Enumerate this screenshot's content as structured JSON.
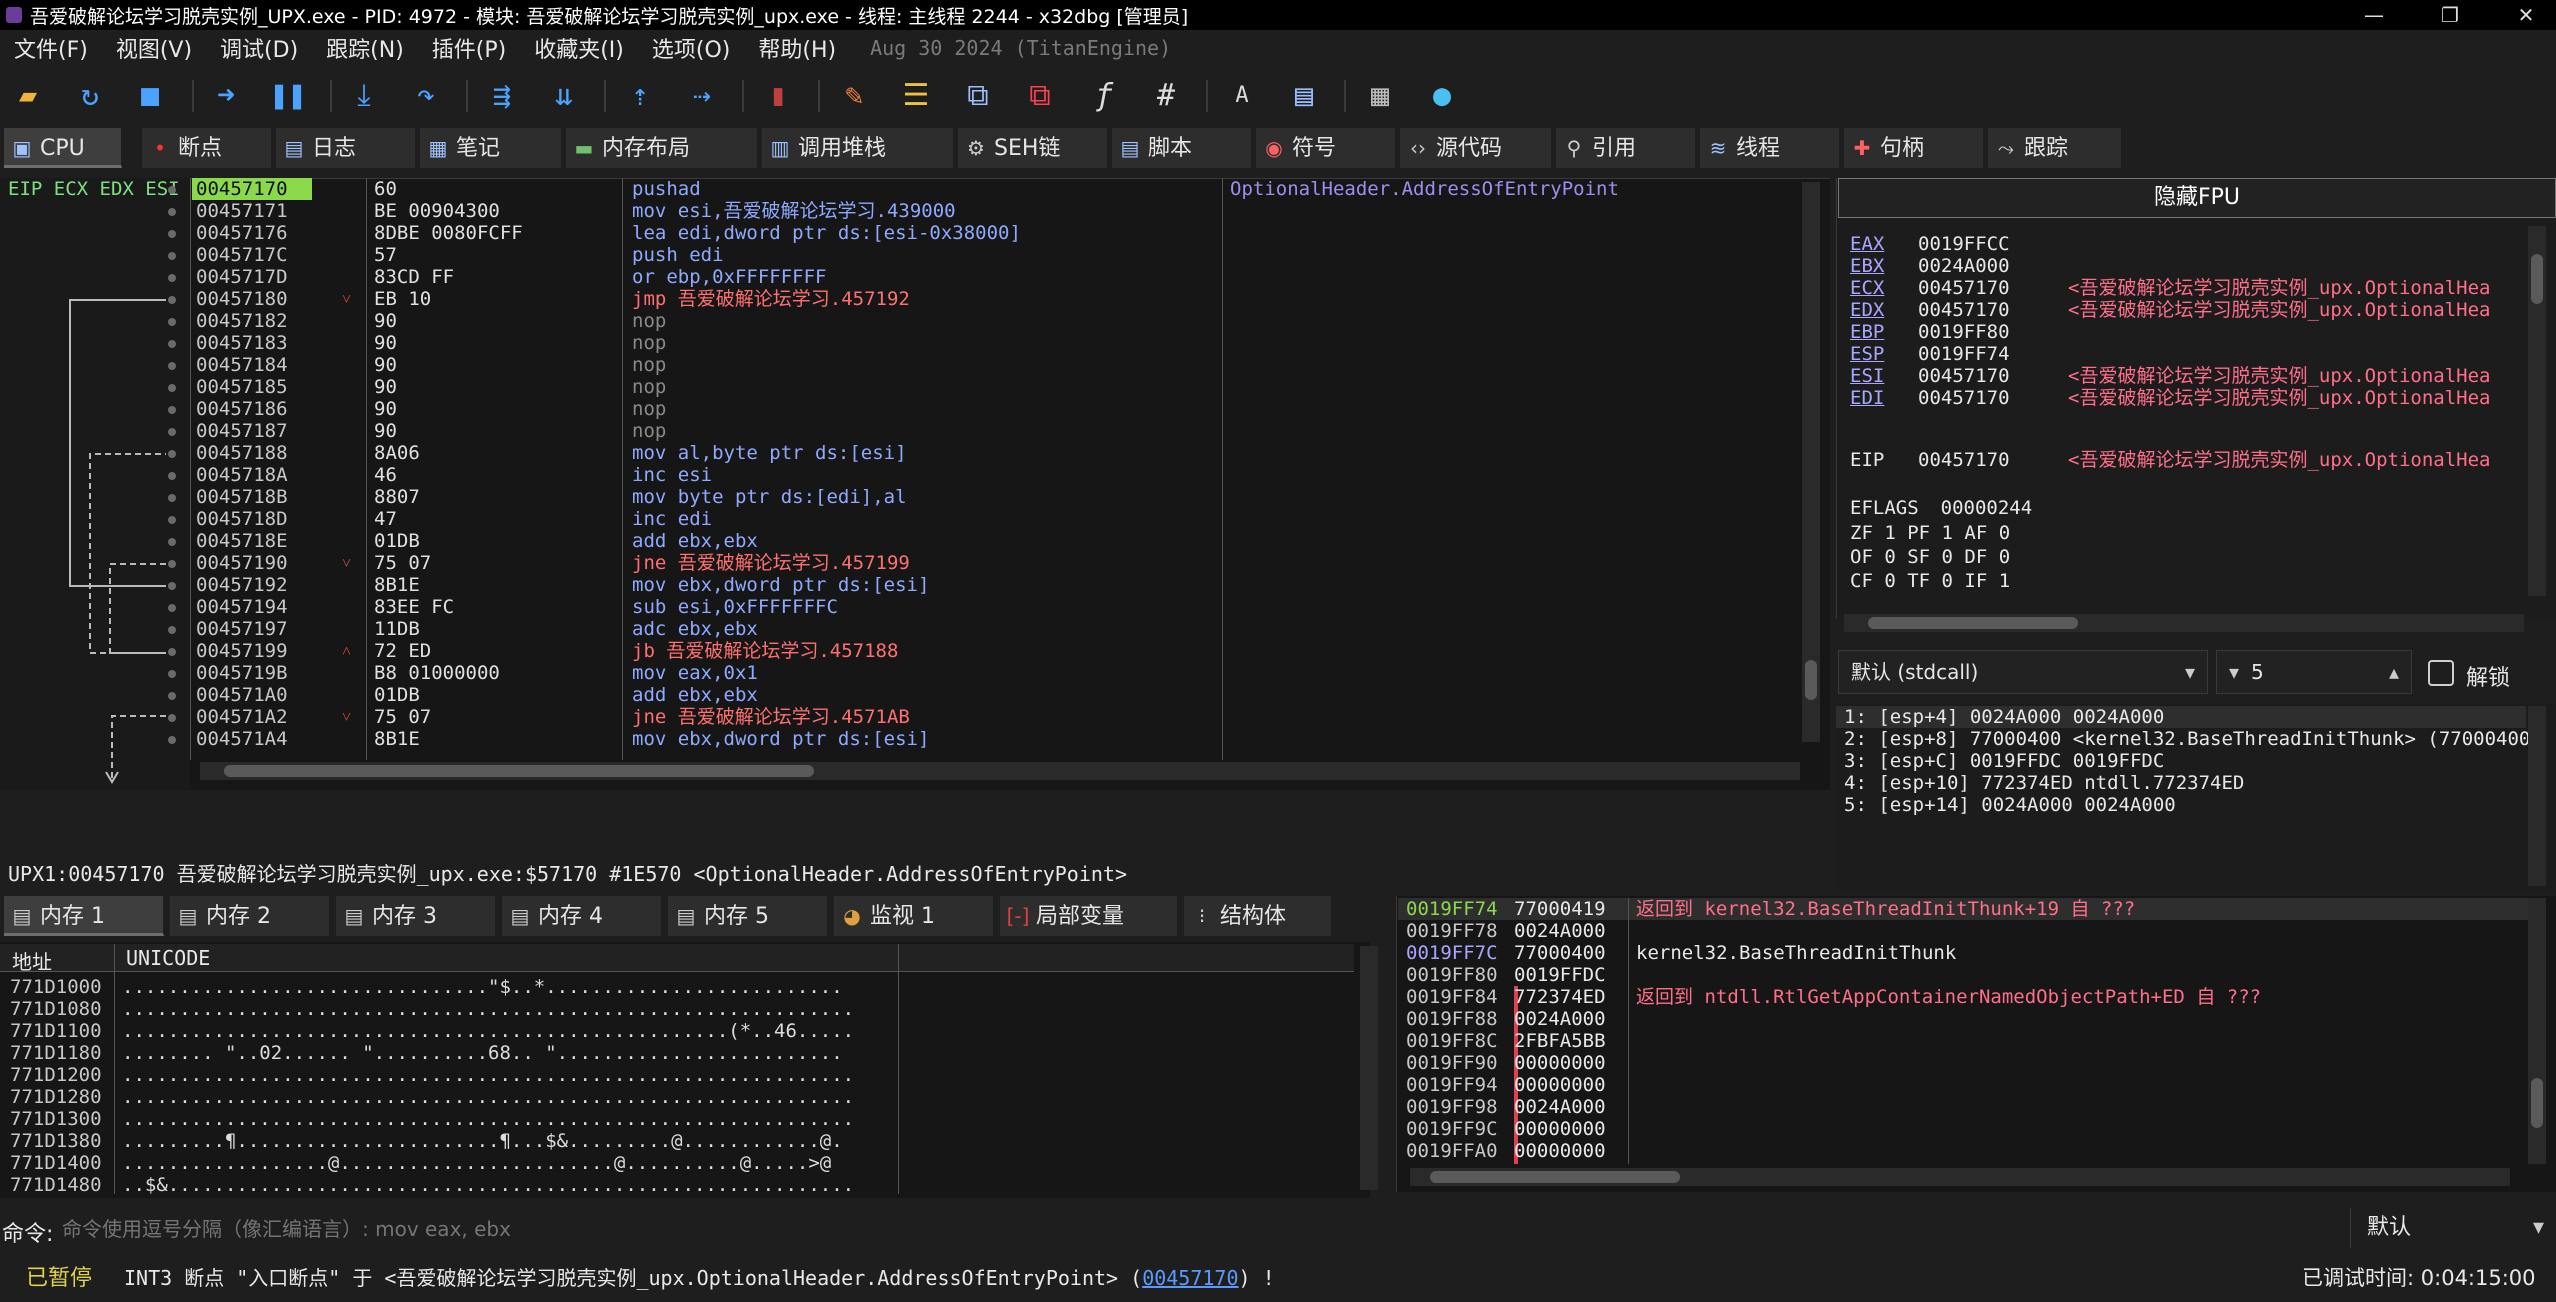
{
  "window": {
    "title": "吾爱破解论坛学习脱壳实例_UPX.exe - PID: 4972 - 模块: 吾爱破解论坛学习脱壳实例_upx.exe - 线程: 主线程 2244 - x32dbg [管理员]",
    "minimize": "—",
    "restore": "❐",
    "close": "✕"
  },
  "menu": {
    "items": [
      "文件(F)",
      "视图(V)",
      "调试(D)",
      "跟踪(N)",
      "插件(P)",
      "收藏夹(I)",
      "选项(O)",
      "帮助(H)"
    ],
    "build": "Aug 30 2024 (TitanEngine)"
  },
  "tabs_top": [
    {
      "label": "CPU",
      "icon": "cpu-icon"
    },
    {
      "label": "断点",
      "icon": "dot-icon"
    },
    {
      "label": "日志",
      "icon": "log-icon"
    },
    {
      "label": "笔记",
      "icon": "note-icon"
    },
    {
      "label": "内存布局",
      "icon": "memory-map-icon"
    },
    {
      "label": "调用堆栈",
      "icon": "callstack-icon"
    },
    {
      "label": "SEH链",
      "icon": "seh-icon"
    },
    {
      "label": "脚本",
      "icon": "script-icon"
    },
    {
      "label": "符号",
      "icon": "symbol-icon"
    },
    {
      "label": "源代码",
      "icon": "source-icon"
    },
    {
      "label": "引用",
      "icon": "reference-icon"
    },
    {
      "label": "线程",
      "icon": "thread-icon"
    },
    {
      "label": "句柄",
      "icon": "handle-icon"
    },
    {
      "label": "跟踪",
      "icon": "trace-icon"
    }
  ],
  "cpu": {
    "gutter_label": "EIP ECX EDX ESI EDI",
    "rows": [
      {
        "addr": "00457170",
        "bytes": "60",
        "instr": "pushad",
        "cmt": "OptionalHeader.AddressOfEntryPoint",
        "mark": ""
      },
      {
        "addr": "00457171",
        "bytes": "BE 00904300",
        "instr": "mov esi,吾爱破解论坛学习.439000",
        "cmt": "",
        "mark": ""
      },
      {
        "addr": "00457176",
        "bytes": "8DBE 0080FCFF",
        "instr": "lea edi,dword ptr  ds:[esi-0x38000]",
        "cmt": "",
        "mark": ""
      },
      {
        "addr": "0045717C",
        "bytes": "57",
        "instr": "push edi",
        "cmt": "",
        "mark": ""
      },
      {
        "addr": "0045717D",
        "bytes": "83CD FF",
        "instr": "or ebp,0xFFFFFFFF",
        "cmt": "",
        "mark": ""
      },
      {
        "addr": "00457180",
        "bytes": "EB 10",
        "instr": "jmp 吾爱破解论坛学习.457192",
        "cmt": "",
        "mark": "˅"
      },
      {
        "addr": "00457182",
        "bytes": "90",
        "instr": "nop",
        "cmt": "",
        "mark": ""
      },
      {
        "addr": "00457183",
        "bytes": "90",
        "instr": "nop",
        "cmt": "",
        "mark": ""
      },
      {
        "addr": "00457184",
        "bytes": "90",
        "instr": "nop",
        "cmt": "",
        "mark": ""
      },
      {
        "addr": "00457185",
        "bytes": "90",
        "instr": "nop",
        "cmt": "",
        "mark": ""
      },
      {
        "addr": "00457186",
        "bytes": "90",
        "instr": "nop",
        "cmt": "",
        "mark": ""
      },
      {
        "addr": "00457187",
        "bytes": "90",
        "instr": "nop",
        "cmt": "",
        "mark": ""
      },
      {
        "addr": "00457188",
        "bytes": "8A06",
        "instr": "mov al,byte ptr  ds:[esi]",
        "cmt": "",
        "mark": ""
      },
      {
        "addr": "0045718A",
        "bytes": "46",
        "instr": "inc esi",
        "cmt": "",
        "mark": ""
      },
      {
        "addr": "0045718B",
        "bytes": "8807",
        "instr": "mov byte ptr  ds:[edi],al",
        "cmt": "",
        "mark": ""
      },
      {
        "addr": "0045718D",
        "bytes": "47",
        "instr": "inc edi",
        "cmt": "",
        "mark": ""
      },
      {
        "addr": "0045718E",
        "bytes": "01DB",
        "instr": "add ebx,ebx",
        "cmt": "",
        "mark": ""
      },
      {
        "addr": "00457190",
        "bytes": "75 07",
        "instr": "jne 吾爱破解论坛学习.457199",
        "cmt": "",
        "mark": "˅"
      },
      {
        "addr": "00457192",
        "bytes": "8B1E",
        "instr": "mov ebx,dword ptr  ds:[esi]",
        "cmt": "",
        "mark": ""
      },
      {
        "addr": "00457194",
        "bytes": "83EE FC",
        "instr": "sub esi,0xFFFFFFFC",
        "cmt": "",
        "mark": ""
      },
      {
        "addr": "00457197",
        "bytes": "11DB",
        "instr": "adc ebx,ebx",
        "cmt": "",
        "mark": ""
      },
      {
        "addr": "00457199",
        "bytes": "72 ED",
        "instr": "jb 吾爱破解论坛学习.457188",
        "cmt": "",
        "mark": "˄"
      },
      {
        "addr": "0045719B",
        "bytes": "B8 01000000",
        "instr": "mov eax,0x1",
        "cmt": "",
        "mark": ""
      },
      {
        "addr": "004571A0",
        "bytes": "01DB",
        "instr": "add ebx,ebx",
        "cmt": "",
        "mark": ""
      },
      {
        "addr": "004571A2",
        "bytes": "75 07",
        "instr": "jne 吾爱破解论坛学习.4571AB",
        "cmt": "",
        "mark": "˅"
      },
      {
        "addr": "004571A4",
        "bytes": "8B1E",
        "instr": "mov ebx,dword ptr  ds:[esi]",
        "cmt": "",
        "mark": ""
      }
    ]
  },
  "info_line": "UPX1:00457170 吾爱破解论坛学习脱壳实例_upx.exe:$57170 #1E570 <OptionalHeader.AddressOfEntryPoint>",
  "registers": {
    "fpu_button": "隐藏FPU",
    "list": [
      {
        "name": "EAX",
        "value": "0019FFCC",
        "info": ""
      },
      {
        "name": "EBX",
        "value": "0024A000",
        "info": ""
      },
      {
        "name": "ECX",
        "value": "00457170",
        "info": "<吾爱破解论坛学习脱壳实例_upx.OptionalHea"
      },
      {
        "name": "EDX",
        "value": "00457170",
        "info": "<吾爱破解论坛学习脱壳实例_upx.OptionalHea"
      },
      {
        "name": "EBP",
        "value": "0019FF80",
        "info": ""
      },
      {
        "name": "ESP",
        "value": "0019FF74",
        "info": ""
      },
      {
        "name": "ESI",
        "value": "00457170",
        "info": "<吾爱破解论坛学习脱壳实例_upx.OptionalHea"
      },
      {
        "name": "EDI",
        "value": "00457170",
        "info": "<吾爱破解论坛学习脱壳实例_upx.OptionalHea"
      }
    ],
    "eip": {
      "name": "EIP",
      "value": "00457170",
      "info": "<吾爱破解论坛学习脱壳实例_upx.OptionalHea"
    },
    "eflags": {
      "name": "EFLAGS",
      "value": "00000244"
    },
    "flags": [
      "ZF 1  PF 1  AF 0",
      "OF 0  SF 0  DF 0",
      "CF 0  TF 0  IF 1"
    ]
  },
  "callconv": {
    "selected": "默认 (stdcall)",
    "count": "5",
    "unlock_label": "解锁",
    "args": [
      "1: [esp+4] 0024A000 0024A000",
      "2: [esp+8] 77000400 <kernel32.BaseThreadInitThunk> (77000400)",
      "3: [esp+C] 0019FFDC 0019FFDC",
      "4: [esp+10] 772374ED ntdll.772374ED",
      "5: [esp+14] 0024A000 0024A000"
    ]
  },
  "tabs_bottom": [
    {
      "label": "内存 1"
    },
    {
      "label": "内存 2"
    },
    {
      "label": "内存 3"
    },
    {
      "label": "内存 4"
    },
    {
      "label": "内存 5"
    },
    {
      "label": "监视 1"
    },
    {
      "label": "局部变量"
    },
    {
      "label": "结构体"
    }
  ],
  "dump": {
    "col_addr": "地址",
    "col_unicode": "UNICODE",
    "rows": [
      {
        "addr": "771D1000",
        "text": "................................\"$..*.........................."
      },
      {
        "addr": "771D1080",
        "text": "................................................................"
      },
      {
        "addr": "771D1100",
        "text": ".....................................................(*..46....."
      },
      {
        "addr": "771D1180",
        "text": "........ \"..02...... \"..........68.. \"........................."
      },
      {
        "addr": "771D1200",
        "text": "................................................................"
      },
      {
        "addr": "771D1280",
        "text": "................................................................"
      },
      {
        "addr": "771D1300",
        "text": "................................................................"
      },
      {
        "addr": "771D1380",
        "text": ".........¶.......................¶...$&.........@............@."
      },
      {
        "addr": "771D1400",
        "text": "..................@........................@..........@.....>@"
      },
      {
        "addr": "771D1480",
        "text": "..$&............................................................"
      }
    ]
  },
  "stack": {
    "rows": [
      {
        "addr": "0019FF74",
        "value": "77000419",
        "cmt": "返回到 kernel32.BaseThreadInitThunk+19 自 ???",
        "red": true
      },
      {
        "addr": "0019FF78",
        "value": "0024A000",
        "cmt": "",
        "red": false
      },
      {
        "addr": "0019FF7C",
        "value": "77000400",
        "cmt": "kernel32.BaseThreadInitThunk",
        "red": false
      },
      {
        "addr": "0019FF80",
        "value": "0019FFDC",
        "cmt": "",
        "red": false
      },
      {
        "addr": "0019FF84",
        "value": "772374ED",
        "cmt": "返回到 ntdll.RtlGetAppContainerNamedObjectPath+ED 自 ???",
        "red": true
      },
      {
        "addr": "0019FF88",
        "value": "0024A000",
        "cmt": "",
        "red": false
      },
      {
        "addr": "0019FF8C",
        "value": "2FBFA5BB",
        "cmt": "",
        "red": false
      },
      {
        "addr": "0019FF90",
        "value": "00000000",
        "cmt": "",
        "red": false
      },
      {
        "addr": "0019FF94",
        "value": "00000000",
        "cmt": "",
        "red": false
      },
      {
        "addr": "0019FF98",
        "value": "0024A000",
        "cmt": "",
        "red": false
      },
      {
        "addr": "0019FF9C",
        "value": "00000000",
        "cmt": "",
        "red": false
      },
      {
        "addr": "0019FFA0",
        "value": "00000000",
        "cmt": "",
        "red": false
      }
    ]
  },
  "command": {
    "label": "命令:",
    "placeholder": "命令使用逗号分隔（像汇编语言）: mov eax, ebx",
    "mode": "默认"
  },
  "status": {
    "state": "已暂停",
    "message_pre": "INT3 断点 \"入口断点\" 于 <吾爱破解论坛学习脱壳实例_upx.OptionalHeader.AddressOfEntryPoint> (",
    "message_link": "00457170",
    "message_post": ") !",
    "time_label": "已调试时间:",
    "time_value": "0:04:15:00"
  }
}
